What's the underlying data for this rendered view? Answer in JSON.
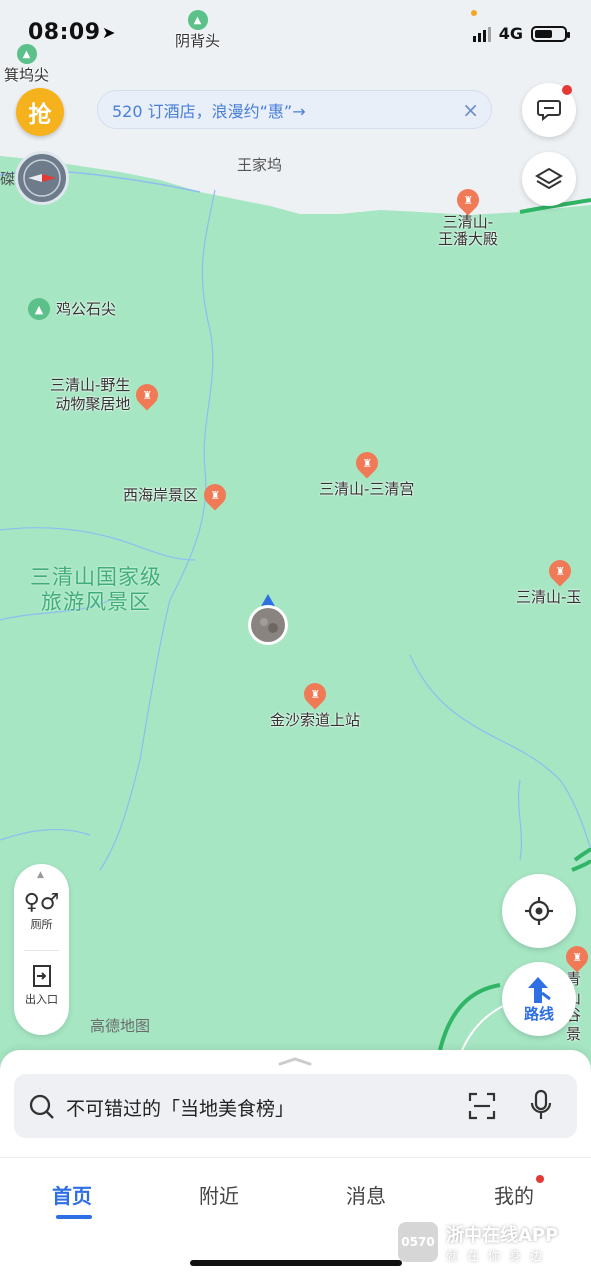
{
  "status_bar": {
    "time": "08:09",
    "network": "4G",
    "battery_level": 0.6
  },
  "map": {
    "banner": {
      "text": "520 订酒店，浪漫约“惠”→",
      "close": "×"
    },
    "promo_button": {
      "label": "抢"
    },
    "region_label": {
      "line1": "三清山国家级",
      "line2": "旅游风景区"
    },
    "villages": {
      "wangjiawu": "王家坞",
      "yinbeitou": "阴背头",
      "jiwujian": "箕坞尖",
      "cut": "磔"
    },
    "pois": {
      "wangpan": {
        "line1": "三清山-",
        "line2": "王潘大殿"
      },
      "jigong": "鸡公石尖",
      "wildlife": {
        "line1": "三清山-野生",
        "line2": "动物聚居地"
      },
      "xihaian": "西海岸景区",
      "sanqinggong": "三清山-三清宫",
      "sanqingyu": "三清山-玉",
      "jinsha": "金沙索道上站",
      "edge": {
        "line1": "青山",
        "line2": "谷景"
      }
    },
    "tools": {
      "toilet": "厕所",
      "entrance": "出入口"
    },
    "route_button": "路线",
    "logo": "高德地图"
  },
  "search": {
    "placeholder": "不可错过的「当地美食榜」"
  },
  "tabs": [
    {
      "label": "首页",
      "active": true
    },
    {
      "label": "附近"
    },
    {
      "label": "消息"
    },
    {
      "label": "我的"
    }
  ],
  "watermark": {
    "logo": "0570",
    "title": "浙中在线APP",
    "subtitle": "就在你身边"
  },
  "colors": {
    "map_green": "#a6e6c3",
    "accent_blue": "#2f6fe4",
    "poi_orange": "#f07a56",
    "badge_red": "#e53935"
  }
}
